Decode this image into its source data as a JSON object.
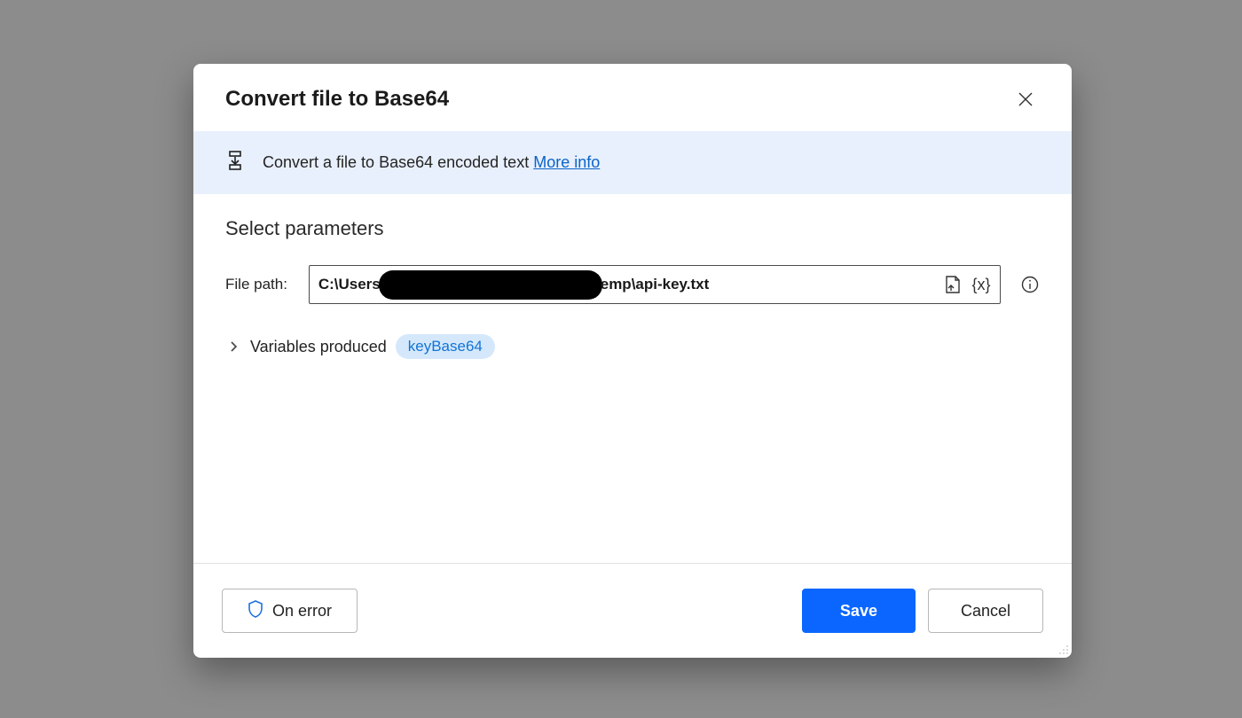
{
  "dialog": {
    "title": "Convert file to Base64",
    "banner_text": "Convert a file to Base64 encoded text ",
    "more_info_label": "More info"
  },
  "params": {
    "section_title": "Select parameters",
    "file_path_label": "File path:",
    "file_path_value_left": "C:\\Users",
    "file_path_value_right": "emp\\api-key.txt",
    "var_token_label": "{x}"
  },
  "vars": {
    "label": "Variables produced",
    "pill": "keyBase64"
  },
  "footer": {
    "on_error_label": "On error",
    "save_label": "Save",
    "cancel_label": "Cancel"
  }
}
